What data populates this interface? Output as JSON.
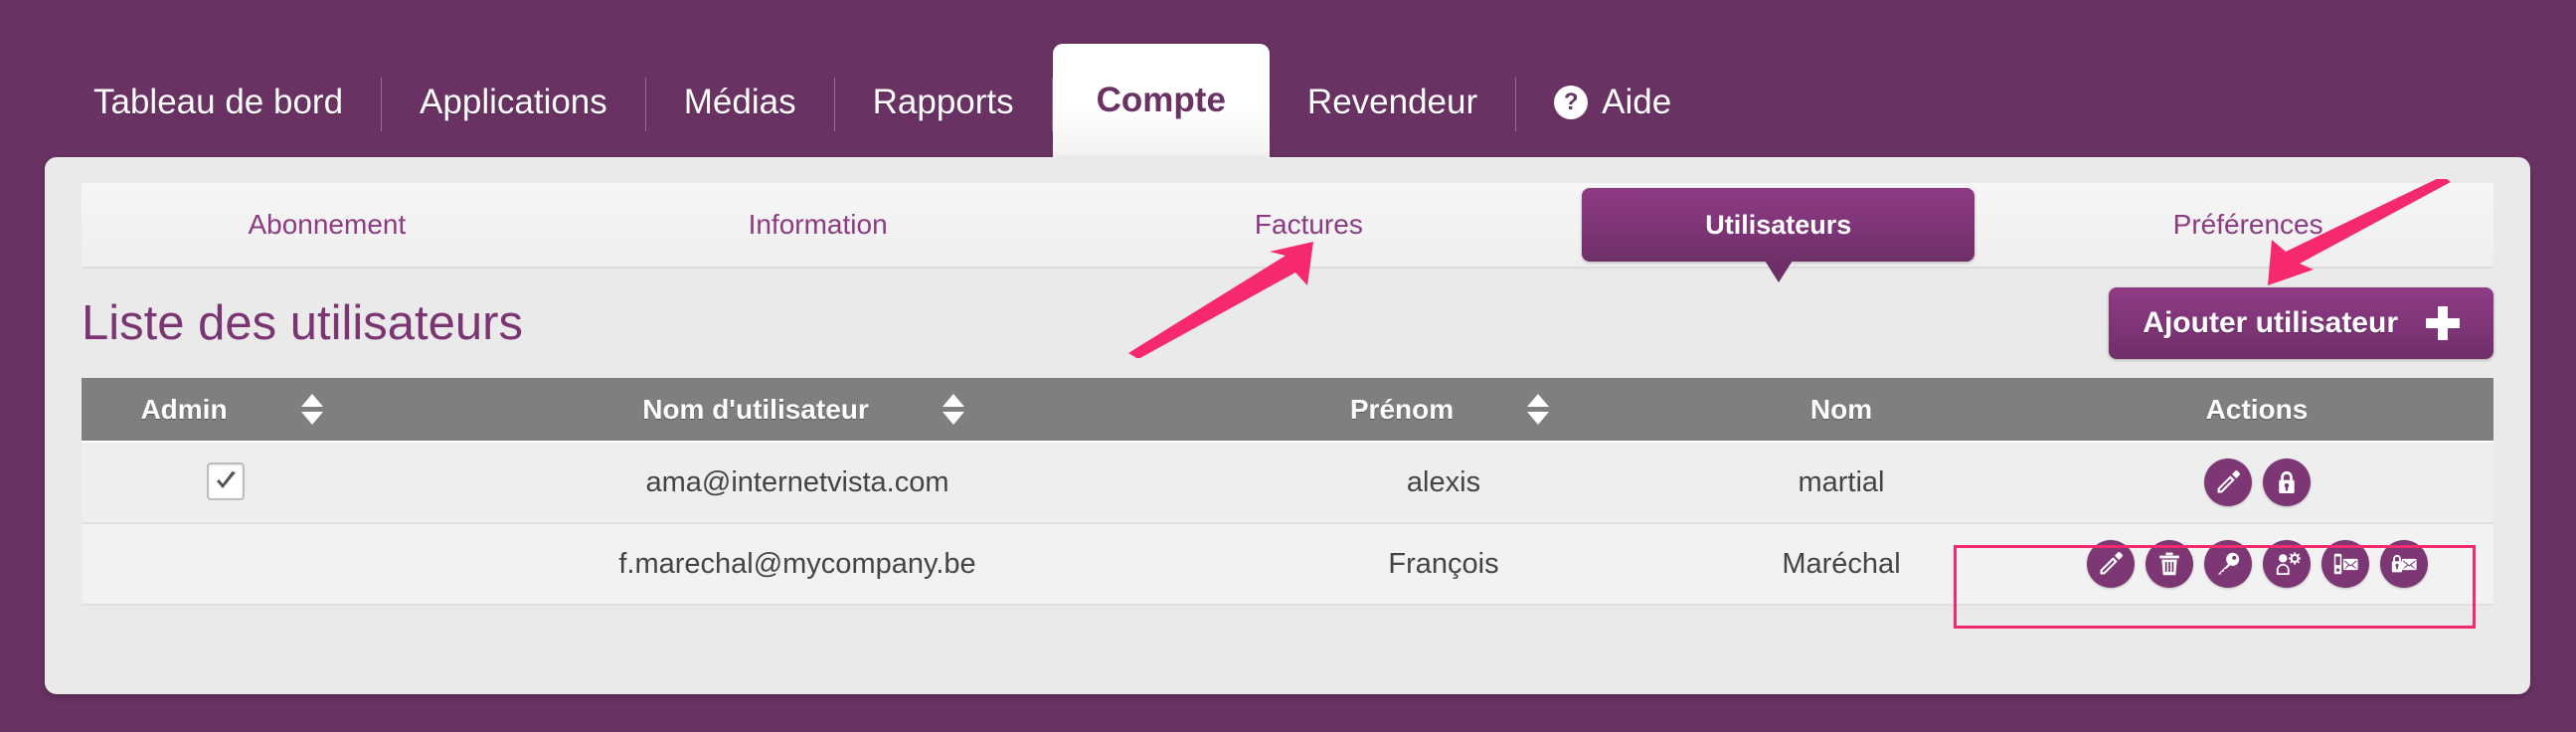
{
  "colors": {
    "brand_purple": "#693263",
    "brand_purple_dark": "#6e2f68",
    "brand_purple_light": "#8f3b86",
    "panel_bg": "#eaeaea",
    "table_header_gray": "#7f7f7f",
    "annotation_pink": "#f5296b",
    "link_purple": "#8c3b82"
  },
  "topnav": {
    "items": [
      {
        "label": "Tableau de bord",
        "name": "nav-tableau-de-bord",
        "active": false
      },
      {
        "label": "Applications",
        "name": "nav-applications",
        "active": false
      },
      {
        "label": "Médias",
        "name": "nav-medias",
        "active": false
      },
      {
        "label": "Rapports",
        "name": "nav-rapports",
        "active": false
      },
      {
        "label": "Compte",
        "name": "nav-compte",
        "active": true
      },
      {
        "label": "Revendeur",
        "name": "nav-revendeur",
        "active": false
      },
      {
        "label": "Aide",
        "name": "nav-aide",
        "active": false,
        "icon": "question-mark-icon",
        "icon_glyph": "?"
      }
    ]
  },
  "subtabs": {
    "items": [
      {
        "label": "Abonnement",
        "active": false
      },
      {
        "label": "Information",
        "active": false
      },
      {
        "label": "Factures",
        "active": false
      },
      {
        "label": "Utilisateurs",
        "active": true
      },
      {
        "label": "Préférences",
        "active": false
      }
    ]
  },
  "page": {
    "title": "Liste des utilisateurs",
    "add_user_label": "Ajouter utilisateur",
    "add_user_icon": "plus-icon"
  },
  "table": {
    "columns": [
      {
        "label": "Admin",
        "sortable": true,
        "sort_icon": "sort-updown-icon"
      },
      {
        "label": "Nom d'utilisateur",
        "sortable": true,
        "sort_icon": "sort-updown-icon"
      },
      {
        "label": "Prénom",
        "sortable": true,
        "sort_icon": "sort-updown-icon"
      },
      {
        "label": "Nom",
        "sortable": false
      },
      {
        "label": "Actions",
        "sortable": false
      }
    ],
    "rows": [
      {
        "admin": true,
        "username": "ama@internetvista.com",
        "firstname": "alexis",
        "lastname": "martial",
        "actions": [
          "pencil-icon",
          "lock-icon"
        ]
      },
      {
        "admin": false,
        "username": "f.marechal@mycompany.be",
        "firstname": "François",
        "lastname": "Maréchal",
        "actions": [
          "pencil-icon",
          "trash-icon",
          "key-icon",
          "user-settings-icon",
          "phone-mail-icon",
          "lock-mail-icon"
        ]
      }
    ]
  },
  "annotations": {
    "arrow_to_utilisateurs_tab": "arrow-pointing-up-right",
    "arrow_to_add_user_button": "arrow-pointing-down-left",
    "highlight_box": "actions-column-row-2"
  }
}
